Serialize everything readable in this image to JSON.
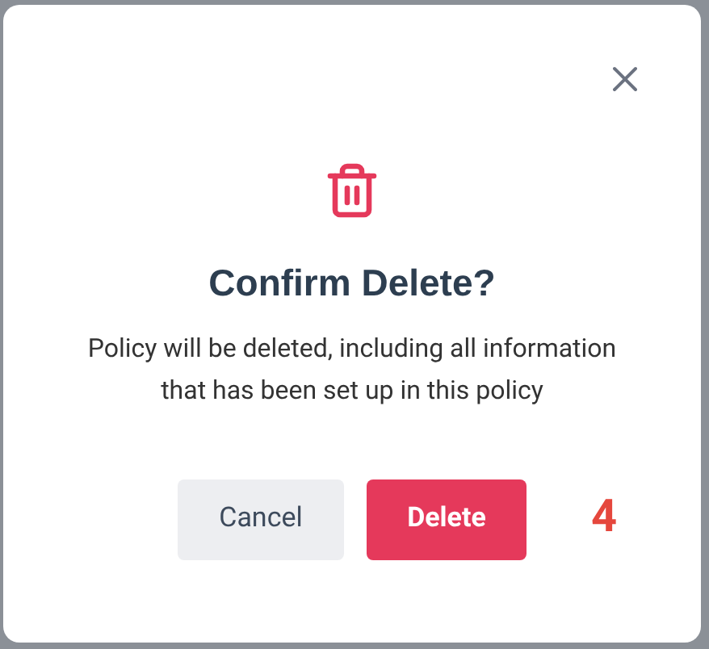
{
  "dialog": {
    "title": "Confirm Delete?",
    "message": "Policy will be deleted, including all information that has been set up in this policy",
    "buttons": [
      {
        "label": "Cancel",
        "kind": "secondary"
      },
      {
        "label": "Delete",
        "kind": "danger"
      }
    ]
  },
  "step_marker": "4"
}
